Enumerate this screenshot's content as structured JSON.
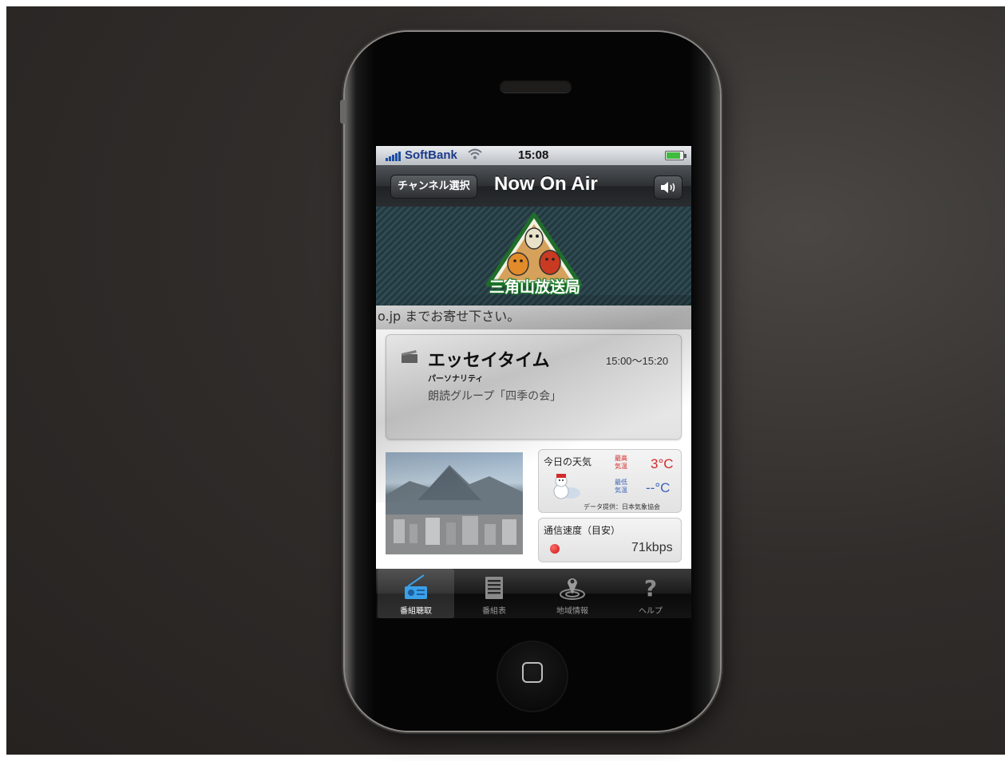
{
  "status_bar": {
    "carrier": "SoftBank",
    "time": "15:08",
    "signal_icon": "signal-bars-icon",
    "wifi_icon": "wifi-icon",
    "battery_icon": "battery-icon",
    "battery_level": 0.85
  },
  "nav": {
    "channel_button": "チャンネル選択",
    "title": "Now On Air",
    "speaker_icon": "speaker-icon"
  },
  "banner": {
    "station_name": "三角山放送局"
  },
  "ticker": {
    "text": "o.jp までお寄せ下さい。"
  },
  "program": {
    "title": "エッセイタイム",
    "time": "15:00〜15:20",
    "personality_label": "パーソナリティ",
    "personality": "朗読グループ「四季の会」"
  },
  "weather": {
    "label": "今日の天気",
    "high_label": "最高気温",
    "high_temp": "3°C",
    "low_label": "最低気温",
    "low_temp": "--°C",
    "credit": "データ提供：日本気象協会",
    "icon": "snowman-icon",
    "colors": {
      "high": "#d42a2a",
      "low": "#3a63b8"
    }
  },
  "speed": {
    "label": "通信速度（目安）",
    "value": "71kbps"
  },
  "tabs": [
    {
      "label": "番組聴取",
      "icon": "radio-icon",
      "active": true
    },
    {
      "label": "番組表",
      "icon": "list-icon",
      "active": false
    },
    {
      "label": "地域情報",
      "icon": "map-pin-icon",
      "active": false
    },
    {
      "label": "ヘルプ",
      "icon": "help-icon",
      "active": false
    }
  ]
}
